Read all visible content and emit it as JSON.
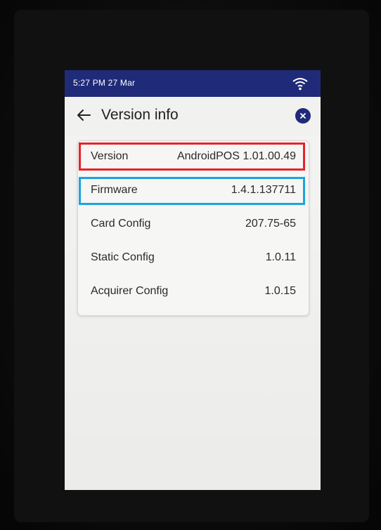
{
  "status_bar": {
    "time_date": "5:27 PM 27 Mar",
    "wifi_icon": "wifi-icon",
    "background_color": "#1f2b78"
  },
  "header": {
    "back_icon": "arrow-left-icon",
    "title": "Version info",
    "close_icon": "close-icon"
  },
  "info_rows": [
    {
      "label": "Version",
      "value": "AndroidPOS 1.01.00.49",
      "highlight": "red"
    },
    {
      "label": "Firmware",
      "value": "1.4.1.137711",
      "highlight": "blue"
    },
    {
      "label": "Card Config",
      "value": "207.75-65"
    },
    {
      "label": "Static Config",
      "value": "1.0.11"
    },
    {
      "label": "Acquirer Config",
      "value": "1.0.15"
    }
  ],
  "colors": {
    "accent": "#1f2b78",
    "highlight_red": "#e8222a",
    "highlight_blue": "#1ba4e0"
  }
}
